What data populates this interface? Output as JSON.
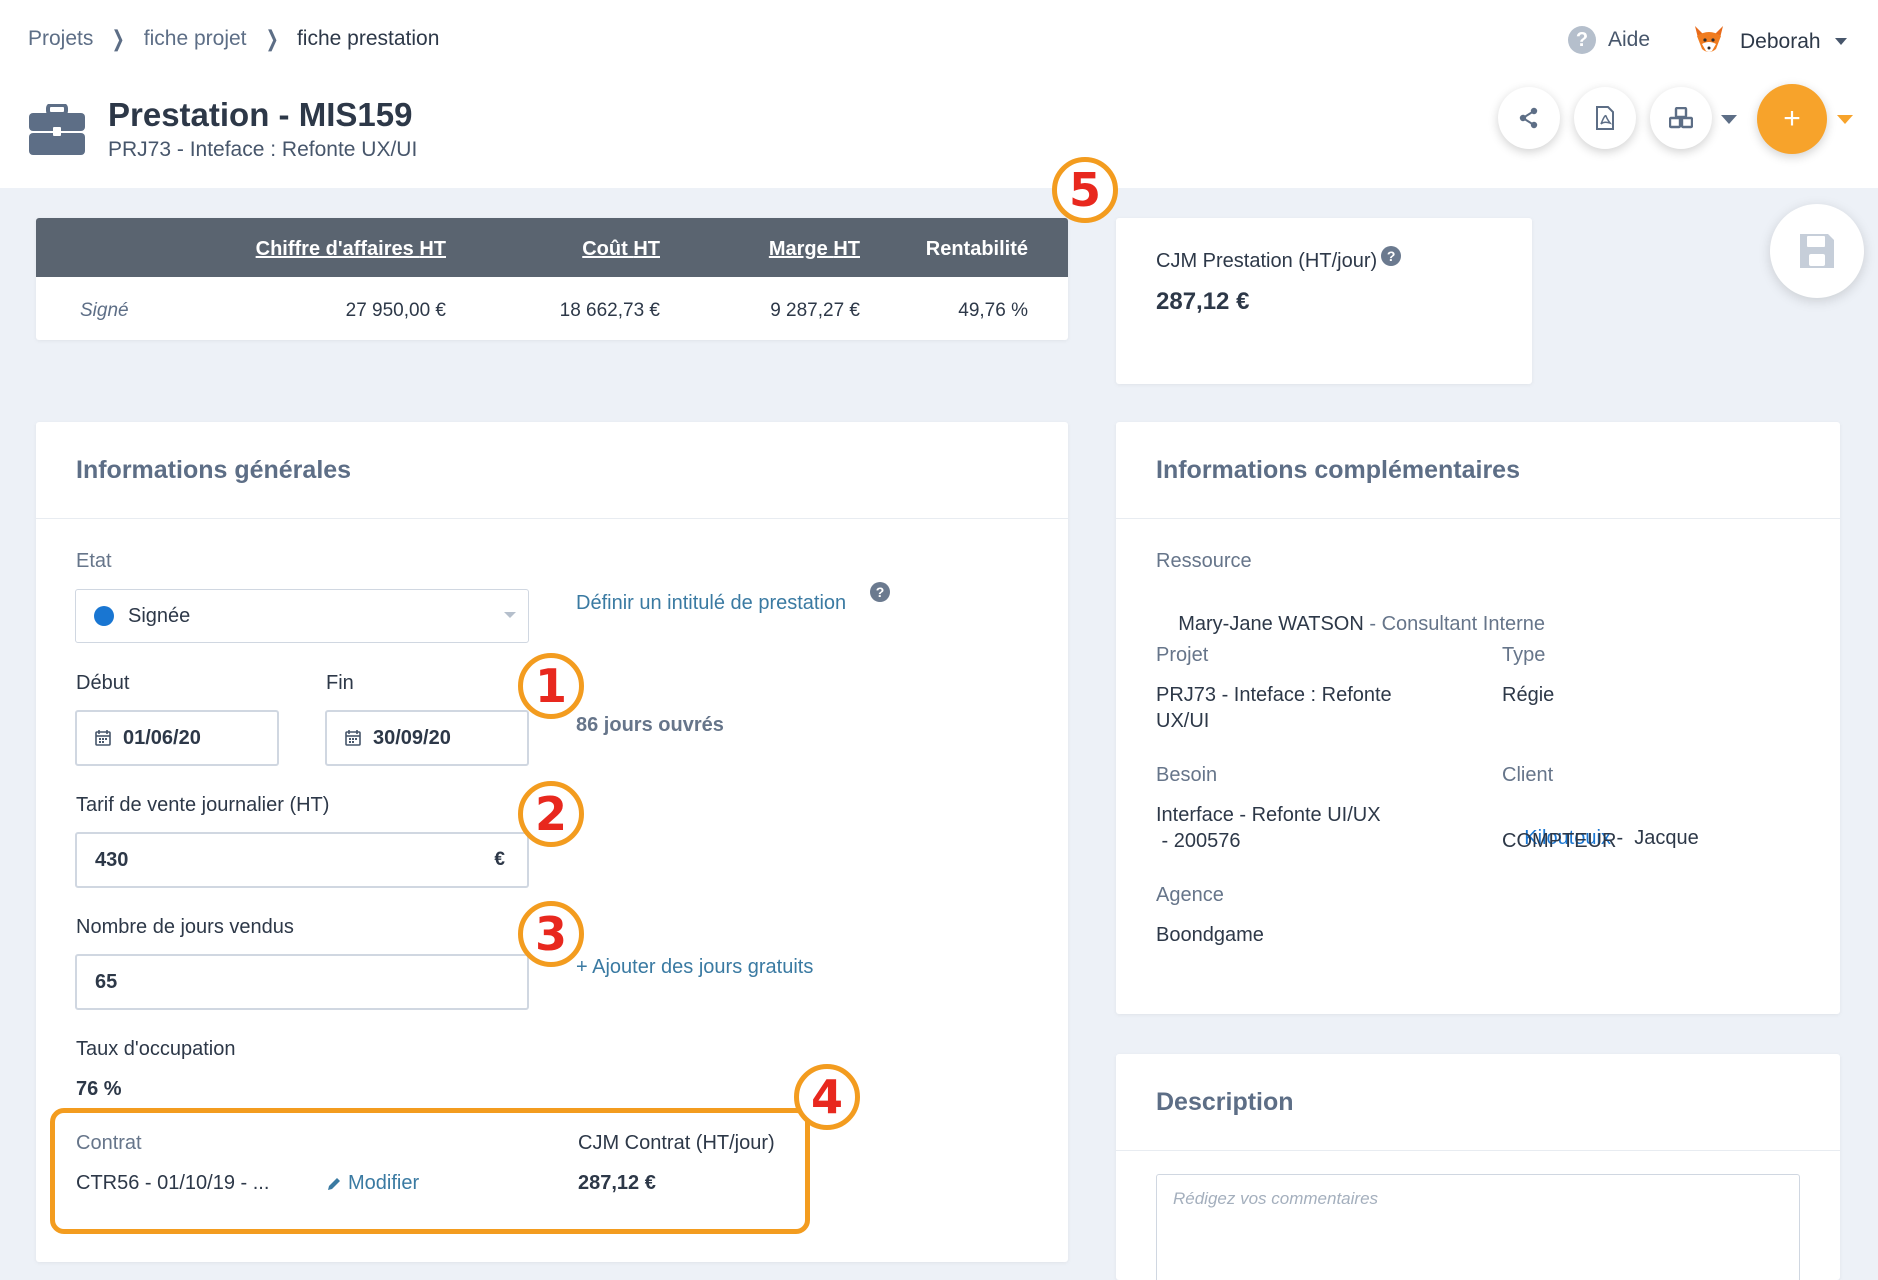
{
  "breadcrumb": {
    "items": [
      "Projets",
      "fiche projet",
      "fiche prestation"
    ]
  },
  "header": {
    "help_label": "Aide",
    "user_name": "Deborah",
    "title": "Prestation - MIS159",
    "subtitle": "PRJ73 - Inteface : Refonte UX/UI",
    "add_label": "+"
  },
  "summary": {
    "headers": [
      "Chiffre d'affaires ",
      "Coût ",
      "Marge ",
      "Rentabilité"
    ],
    "ht_suffix": "HT",
    "row_label": "Signé",
    "values": [
      "27 950,00 €",
      "18 662,73 €",
      "9 287,27 €",
      "49,76 %"
    ]
  },
  "cjm_card": {
    "label": "CJM Prestation (HT/jour)",
    "value": "287,12 €"
  },
  "general": {
    "title": "Informations générales",
    "etat_label": "Etat",
    "etat_value": "Signée",
    "define_link": "Définir un intitulé de prestation",
    "debut_label": "Début",
    "debut_value": "01/06/20",
    "fin_label": "Fin",
    "fin_value": "30/09/20",
    "jours_ouvres": "86 jours ouvrés",
    "tarif_label": "Tarif de vente journalier (HT)",
    "tarif_value": "430",
    "currency": "€",
    "jours_label": "Nombre de jours vendus",
    "jours_value": "65",
    "add_free_days": "+ Ajouter des jours gratuits",
    "taux_label": "Taux d'occupation",
    "taux_value": "76 %",
    "contrat_label": "Contrat",
    "contrat_value": "CTR56 - 01/10/19 - ...",
    "modifier_label": "Modifier",
    "cjm_contrat_label": "CJM Contrat (HT/jour)",
    "cjm_contrat_value": "287,12 €"
  },
  "complementary": {
    "title": "Informations complémentaires",
    "ressource_label": "Ressource",
    "ressource_name": "Mary-Jane WATSON",
    "ressource_role": " - Consultant Interne",
    "projet_label": "Projet",
    "projet_line1": "PRJ73 - Inteface : Refonte",
    "projet_line2": "UX/UI",
    "type_label": "Type",
    "type_value": "Régie",
    "besoin_label": "Besoin",
    "besoin_line1": "Interface - Refonte UI/UX",
    "besoin_line2": " - 200576",
    "client_label": "Client",
    "client_link": "Kiloutouix",
    "client_rest": " -  Jacque",
    "client_line2": "COMPTEUR",
    "agence_label": "Agence",
    "agence_value": "Boondgame"
  },
  "description": {
    "title": "Description",
    "placeholder": "Rédigez vos commentaires"
  },
  "badges": [
    "1",
    "2",
    "3",
    "4",
    "5"
  ],
  "colors": {
    "accent": "#f7a32b",
    "badge_ring": "#f39c1f",
    "badge_number": "#e8281e",
    "link": "#3a7aa2",
    "status_dot": "#1976d2",
    "table_header": "#5a6470"
  }
}
